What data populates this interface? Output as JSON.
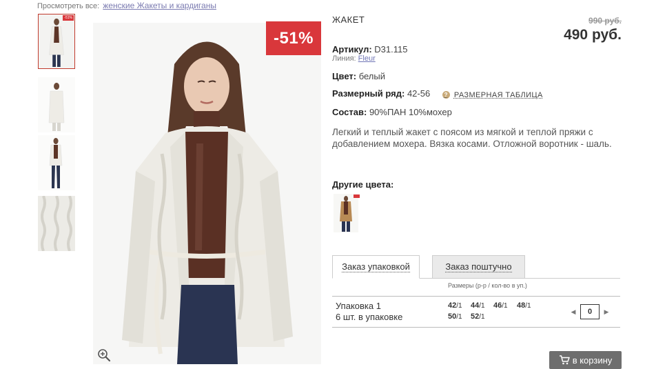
{
  "breadcrumb": {
    "prefix": "Просмотреть все:",
    "link": "женские Жакеты и кардиганы"
  },
  "gallery": {
    "thumbnails": [
      {
        "label": "-51%",
        "active": true
      },
      {
        "label": "",
        "active": false
      },
      {
        "label": "",
        "active": false
      },
      {
        "label": "",
        "active": false
      }
    ],
    "sale_badge": "-51%",
    "zoom_icon": "zoom-in-icon"
  },
  "product": {
    "title": "ЖАКЕТ",
    "old_price": "990 руб.",
    "new_price": "490 руб.",
    "article_label": "Артикул:",
    "article_value": "D31.115",
    "line_label": "Линия:",
    "line_value": "Fleur",
    "color_label": "Цвет:",
    "color_value": "белый",
    "size_range_label": "Размерный ряд:",
    "size_range_value": "42-56",
    "size_table_link": "РАЗМЕРНАЯ ТАБЛИЦА",
    "composition_label": "Состав:",
    "composition_value": "90%ПАН 10%мохер",
    "description": "Легкий и теплый жакет с поясом из мягкой и теплой пряжи с добавлением мохера. Вязка косами. Отложной воротник - шаль.",
    "other_colors_label": "Другие цвета:"
  },
  "order": {
    "tabs": [
      "Заказ упаковкой",
      "Заказ поштучно"
    ],
    "sizes_header": "Размеры (р-р / кол-во в уп.)",
    "pack_name": "Упаковка 1",
    "pack_count": "6 шт. в упаковке",
    "sizes": [
      {
        "size": "42",
        "qty": "/1"
      },
      {
        "size": "44",
        "qty": "/1"
      },
      {
        "size": "46",
        "qty": "/1"
      },
      {
        "size": "48",
        "qty": "/1"
      },
      {
        "size": "50",
        "qty": "/1"
      },
      {
        "size": "52",
        "qty": "/1"
      }
    ],
    "quantity": "0",
    "cart_button": "в корзину"
  },
  "colors": {
    "accent_red": "#d9373b",
    "cart_button": "#6e6e6e",
    "link": "#7a7ab0"
  }
}
